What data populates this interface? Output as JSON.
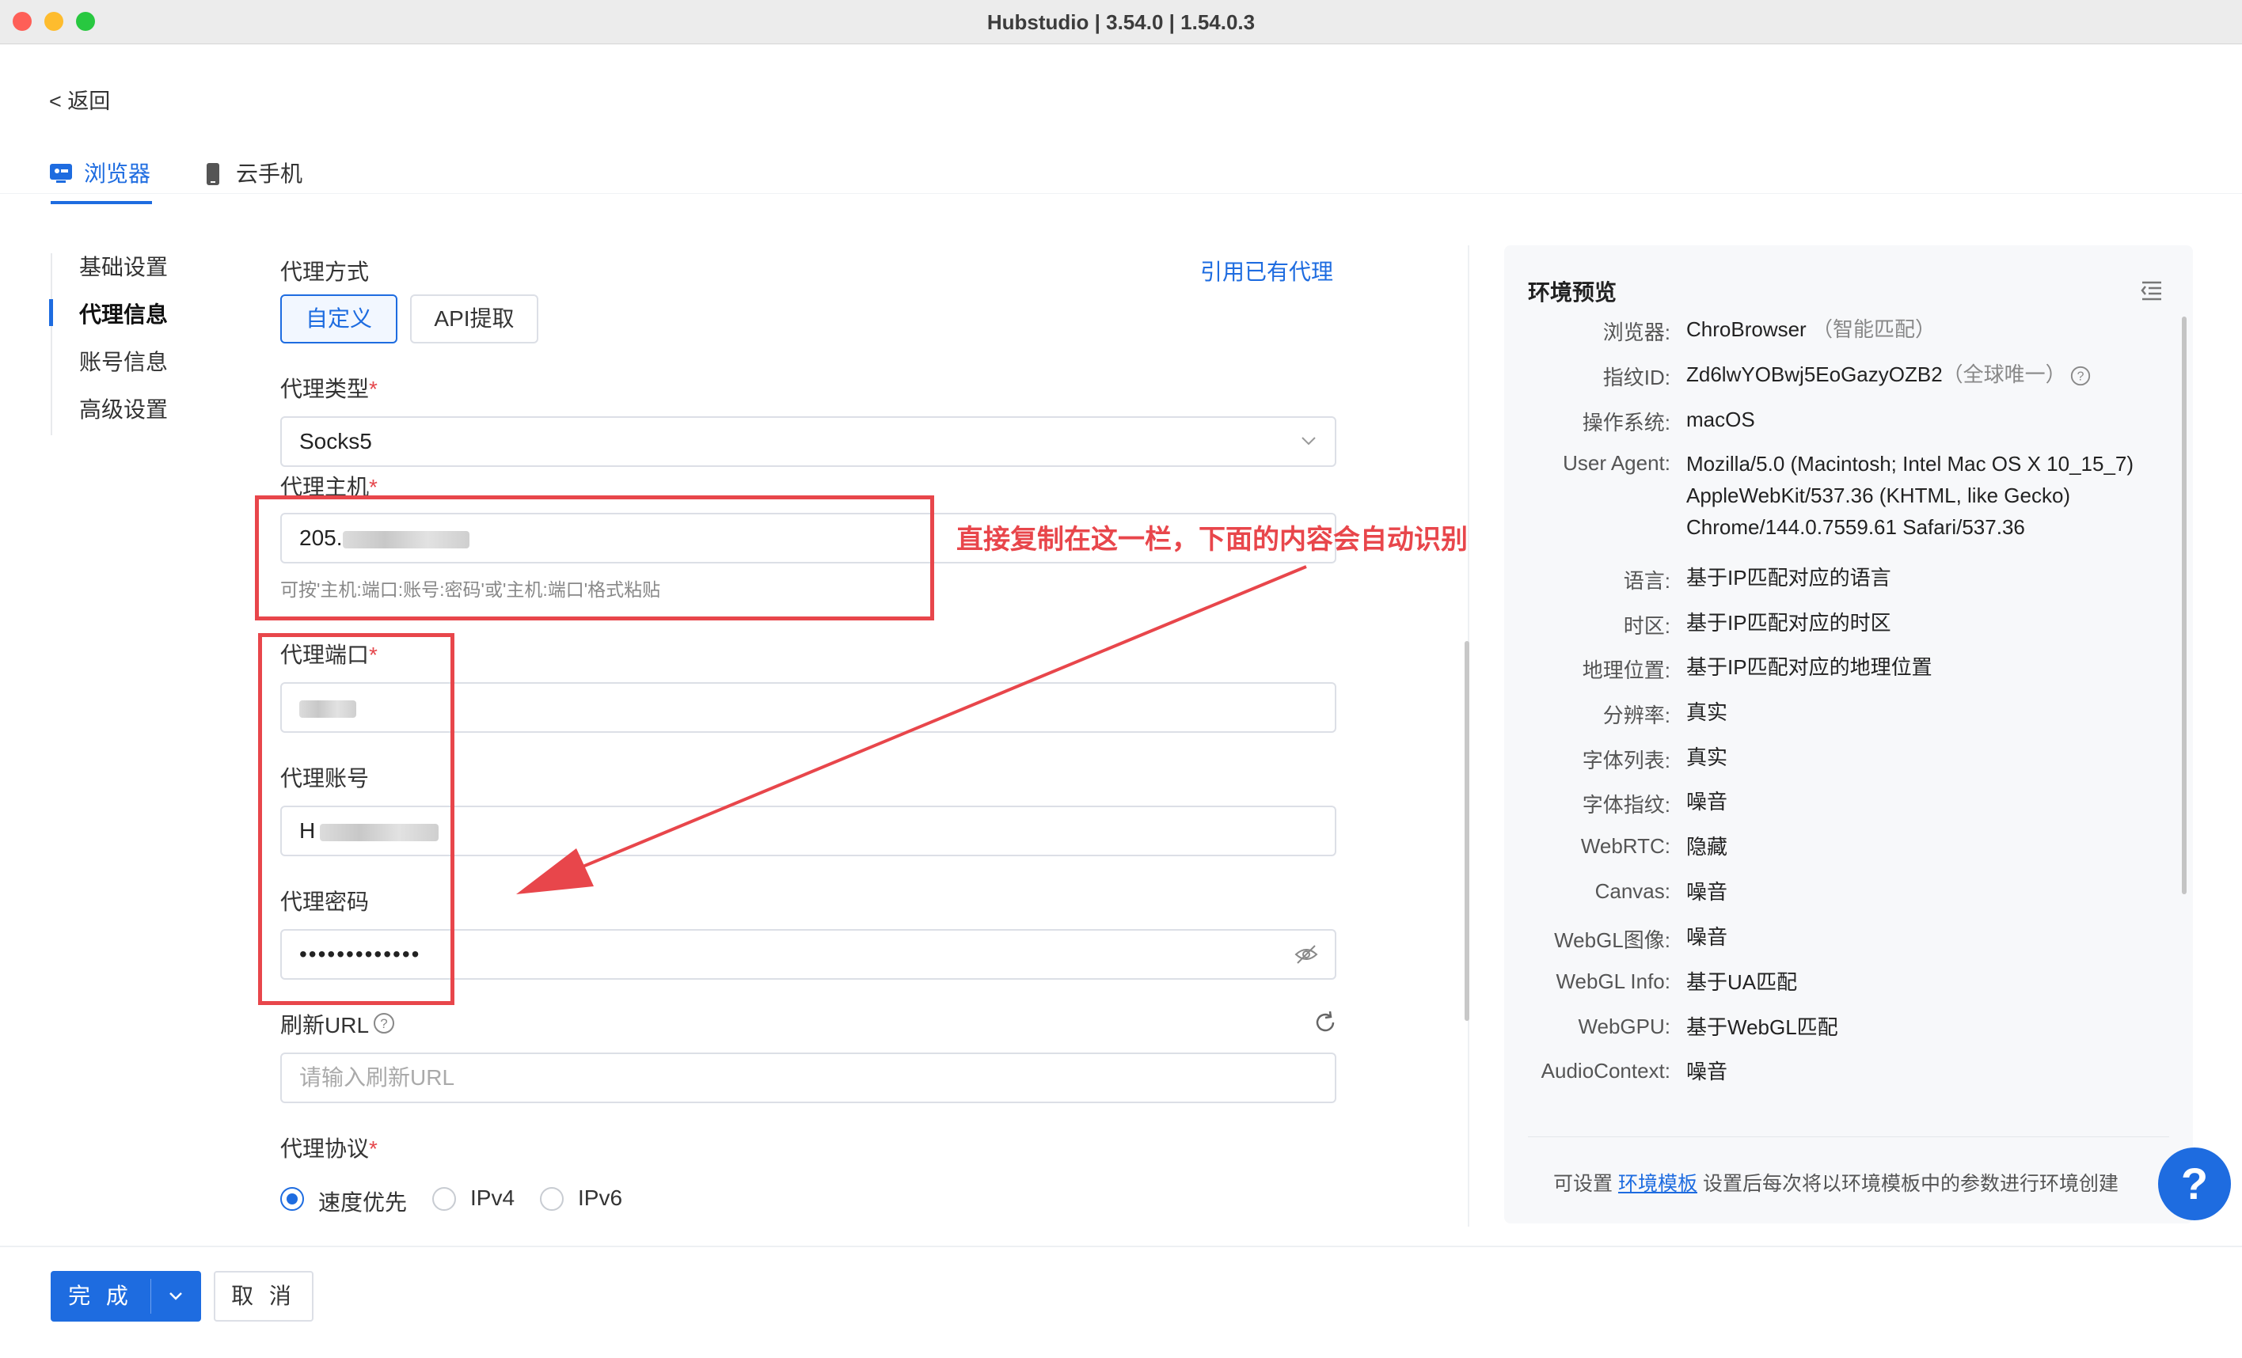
{
  "window": {
    "title": "Hubstudio | 3.54.0 | 1.54.0.3"
  },
  "back": "< 返回",
  "tabs": [
    {
      "label": "浏览器",
      "icon": "browser-icon",
      "active": true
    },
    {
      "label": "云手机",
      "icon": "phone-icon",
      "active": false
    }
  ],
  "nav": [
    {
      "label": "基础设置",
      "active": false
    },
    {
      "label": "代理信息",
      "active": true
    },
    {
      "label": "账号信息",
      "active": false
    },
    {
      "label": "高级设置",
      "active": false
    }
  ],
  "form": {
    "proxy_method_label": "代理方式",
    "use_existing_link": "引用已有代理",
    "method_options": [
      "自定义",
      "API提取"
    ],
    "proxy_type_label": "代理类型",
    "proxy_type_value": "Socks5",
    "host_label": "代理主机",
    "host_value_prefix": "205.",
    "host_hint": "可按'主机:端口:账号:密码'或'主机:端口'格式粘贴",
    "port_label": "代理端口",
    "account_label": "代理账号",
    "account_value_prefix": "H",
    "password_label": "代理密码",
    "password_value": "•••••••••••••",
    "refresh_url_label": "刷新URL",
    "refresh_url_placeholder": "请输入刷新URL",
    "protocol_label": "代理协议",
    "protocol_options": [
      "速度优先",
      "IPv4",
      "IPv6"
    ],
    "protocol_selected": "速度优先",
    "required_mark": "*"
  },
  "annotation": {
    "text": "直接复制在这一栏，下面的内容会自动识别",
    "color": "#e8464b"
  },
  "preview": {
    "title": "环境预览",
    "rows": [
      {
        "key": "浏览器:",
        "value": "ChroBrowser",
        "note": "（智能匹配）"
      },
      {
        "key": "指纹ID:",
        "value": "Zd6lwYOBwj5EoGazyOZB2",
        "note": "（全球唯一）"
      },
      {
        "key": "操作系统:",
        "value": "macOS"
      },
      {
        "key": "User Agent:",
        "value": "Mozilla/5.0 (Macintosh; Intel Mac OS X 10_15_7) AppleWebKit/537.36 (KHTML, like Gecko) Chrome/144.0.7559.61 Safari/537.36"
      },
      {
        "key": "语言:",
        "value": "基于IP匹配对应的语言"
      },
      {
        "key": "时区:",
        "value": "基于IP匹配对应的时区"
      },
      {
        "key": "地理位置:",
        "value": "基于IP匹配对应的地理位置"
      },
      {
        "key": "分辨率:",
        "value": "真实"
      },
      {
        "key": "字体列表:",
        "value": "真实"
      },
      {
        "key": "字体指纹:",
        "value": "噪音"
      },
      {
        "key": "WebRTC:",
        "value": "隐藏"
      },
      {
        "key": "Canvas:",
        "value": "噪音"
      },
      {
        "key": "WebGL图像:",
        "value": "噪音"
      },
      {
        "key": "WebGL Info:",
        "value": "基于UA匹配"
      },
      {
        "key": "WebGPU:",
        "value": "基于WebGL匹配"
      },
      {
        "key": "AudioContext:",
        "value": "噪音"
      }
    ],
    "footer_prefix": "可设置",
    "footer_link": "环境模板",
    "footer_suffix": "设置后每次将以环境模板中的参数进行环境创建"
  },
  "bottom": {
    "done_label": "完 成",
    "cancel_label": "取 消"
  },
  "help_label": "?",
  "colors": {
    "accent": "#1e6ce0",
    "required": "#e5484d"
  }
}
